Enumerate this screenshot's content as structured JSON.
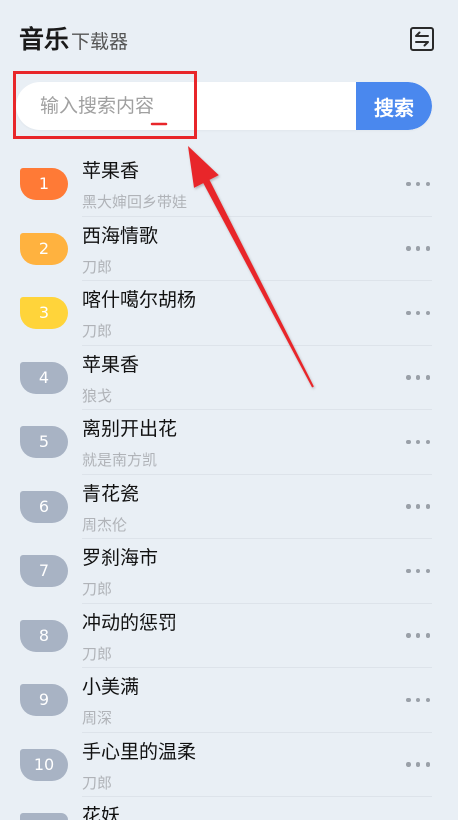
{
  "header": {
    "title": "音乐",
    "subtitle": "下载器",
    "swap_icon": "swap-icon"
  },
  "search": {
    "placeholder": "输入搜索内容",
    "value": "",
    "button_label": "搜索"
  },
  "row_more_icon": "more-horizontal-icon",
  "songs": [
    {
      "rank": "1",
      "title": "苹果香",
      "artist": "黑大婶回乡带娃"
    },
    {
      "rank": "2",
      "title": "西海情歌",
      "artist": "刀郎"
    },
    {
      "rank": "3",
      "title": "喀什噶尔胡杨",
      "artist": "刀郎"
    },
    {
      "rank": "4",
      "title": "苹果香",
      "artist": "狼戈"
    },
    {
      "rank": "5",
      "title": "离别开出花",
      "artist": "就是南方凯"
    },
    {
      "rank": "6",
      "title": "青花瓷",
      "artist": "周杰伦"
    },
    {
      "rank": "7",
      "title": "罗刹海市",
      "artist": "刀郎"
    },
    {
      "rank": "8",
      "title": "冲动的惩罚",
      "artist": "刀郎"
    },
    {
      "rank": "9",
      "title": "小美满",
      "artist": "周深"
    },
    {
      "rank": "10",
      "title": "手心里的温柔",
      "artist": "刀郎"
    }
  ],
  "partial_song": {
    "title": "花妖"
  },
  "colors": {
    "background": "#e9eff5",
    "accent": "#4a88ee",
    "annotation": "#e8262a",
    "badge_rank1": "#ff7a36",
    "badge_rank2": "#ffb23f",
    "badge_rank3": "#ffd43a",
    "badge_default": "#a8b3c4"
  }
}
